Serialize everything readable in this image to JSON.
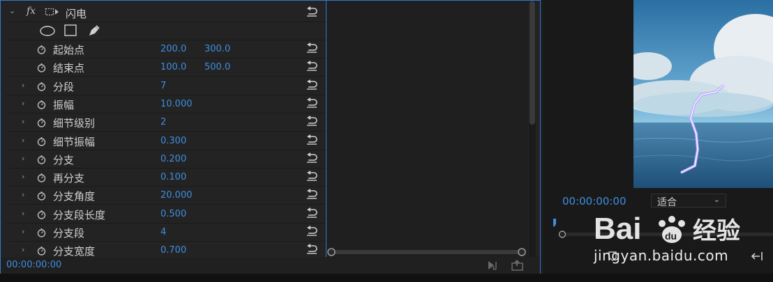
{
  "effect": {
    "name": "闪电",
    "fx_label": "fx"
  },
  "mask_tools": [
    "ellipse-mask-icon",
    "rectangle-mask-icon",
    "pen-mask-icon"
  ],
  "properties": [
    {
      "name": "起始点",
      "v1": "200.0",
      "v2": "300.0",
      "twirl": false
    },
    {
      "name": "结束点",
      "v1": "100.0",
      "v2": "500.0",
      "twirl": false
    },
    {
      "name": "分段",
      "v1": "7",
      "twirl": true
    },
    {
      "name": "振幅",
      "v1": "10.000",
      "twirl": true
    },
    {
      "name": "细节级别",
      "v1": "2",
      "twirl": true
    },
    {
      "name": "细节振幅",
      "v1": "0.300",
      "twirl": true
    },
    {
      "name": "分支",
      "v1": "0.200",
      "twirl": true
    },
    {
      "name": "再分支",
      "v1": "0.100",
      "twirl": true
    },
    {
      "name": "分支角度",
      "v1": "20.000",
      "twirl": true
    },
    {
      "name": "分支段长度",
      "v1": "0.500",
      "twirl": true
    },
    {
      "name": "分支段",
      "v1": "4",
      "twirl": true
    },
    {
      "name": "分支宽度",
      "v1": "0.700",
      "twirl": true
    }
  ],
  "footer": {
    "timecode": "00:00:00:00"
  },
  "monitor": {
    "timecode": "00:00:00:00",
    "fit_value": "适合"
  },
  "watermark": {
    "site": "jingyan.baidu.com"
  },
  "colors": {
    "accent": "#3d8fe0",
    "panel_border": "#2f79d6",
    "lightning": "#b9a8ff"
  }
}
